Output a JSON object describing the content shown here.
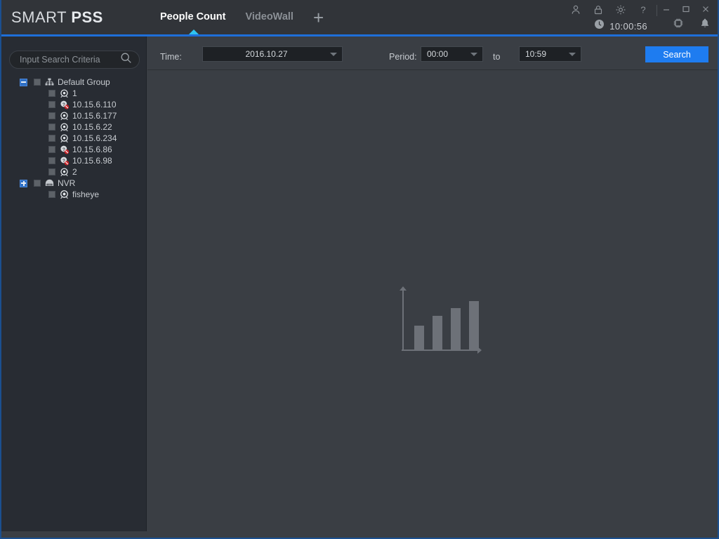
{
  "app": {
    "brand_prefix": "SMART ",
    "brand_suffix": "PSS",
    "accent_color": "#1e7cf0",
    "tab_indicator_color": "#2fc3f0"
  },
  "header": {
    "tabs": [
      {
        "label": "People Count",
        "active": true
      },
      {
        "label": "VideoWall",
        "active": false
      }
    ],
    "add_tab_label": "+",
    "system_icons": [
      {
        "name": "user-icon"
      },
      {
        "name": "lock-icon"
      },
      {
        "name": "gear-icon"
      },
      {
        "name": "help-icon"
      }
    ],
    "window_buttons": [
      {
        "name": "minimize-button",
        "label": "—"
      },
      {
        "name": "maximize-button",
        "label": "□"
      },
      {
        "name": "close-button",
        "label": "✕"
      }
    ],
    "clock": {
      "icon": "clock-icon",
      "time": "10:00:56"
    },
    "status_icons": [
      {
        "name": "cpu-icon"
      },
      {
        "name": "bell-icon"
      }
    ]
  },
  "sidebar": {
    "search": {
      "placeholder": "Input Search Criteria",
      "value": "",
      "icon": "search-icon"
    },
    "tree": [
      {
        "label": "Default Group",
        "icon": "group-icon",
        "level": 0,
        "toggle": "minus",
        "checked": false
      },
      {
        "label": "1",
        "icon": "camera-icon",
        "level": 1,
        "toggle": null,
        "checked": false
      },
      {
        "label": "10.15.6.110",
        "icon": "camera-offline-icon",
        "level": 1,
        "toggle": null,
        "checked": false
      },
      {
        "label": "10.15.6.177",
        "icon": "camera-icon",
        "level": 1,
        "toggle": null,
        "checked": false
      },
      {
        "label": "10.15.6.22",
        "icon": "camera-icon",
        "level": 1,
        "toggle": null,
        "checked": false
      },
      {
        "label": "10.15.6.234",
        "icon": "camera-icon",
        "level": 1,
        "toggle": null,
        "checked": false
      },
      {
        "label": "10.15.6.86",
        "icon": "camera-offline-icon",
        "level": 1,
        "toggle": null,
        "checked": false
      },
      {
        "label": "10.15.6.98",
        "icon": "camera-offline-icon",
        "level": 1,
        "toggle": null,
        "checked": false
      },
      {
        "label": "2",
        "icon": "camera-icon",
        "level": 1,
        "toggle": null,
        "checked": false
      },
      {
        "label": "NVR",
        "icon": "nvr-icon",
        "level": 0,
        "toggle": "plus",
        "checked": false
      },
      {
        "label": "fisheye",
        "icon": "fisheye-icon",
        "level": 1,
        "toggle": null,
        "checked": false
      }
    ]
  },
  "toolbar": {
    "time_label": "Time:",
    "date_value": "2016.10.27",
    "period_label": "Period:",
    "period_start": "00:00",
    "period_to_label": "to",
    "period_end": "10:59",
    "search_label": "Search"
  },
  "main": {
    "empty_placeholder": "bar-chart-placeholder"
  }
}
